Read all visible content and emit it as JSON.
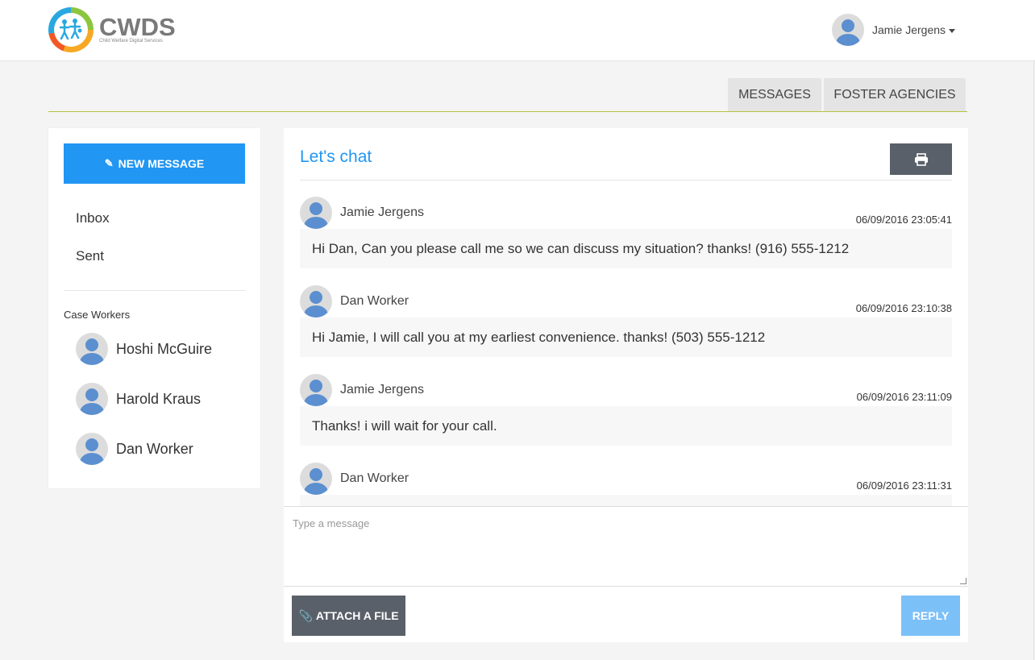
{
  "header": {
    "logo_text": "CWDS",
    "logo_subtitle": "Child Welfare Digital Services",
    "user_name": "Jamie Jergens"
  },
  "tabs": [
    {
      "label": "MESSAGES"
    },
    {
      "label": "FOSTER AGENCIES"
    }
  ],
  "sidebar": {
    "new_message_label": "NEW MESSAGE",
    "nav": [
      {
        "label": "Inbox"
      },
      {
        "label": "Sent"
      }
    ],
    "case_workers_title": "Case Workers",
    "case_workers": [
      {
        "name": "Hoshi McGuire"
      },
      {
        "name": "Harold Kraus"
      },
      {
        "name": "Dan Worker"
      }
    ]
  },
  "chat": {
    "title": "Let's chat",
    "messages": [
      {
        "sender": "Jamie Jergens",
        "timestamp": "06/09/2016 23:05:41",
        "text": "Hi Dan, Can you please call me so we can discuss my situation? thanks! (916) 555-1212"
      },
      {
        "sender": "Dan Worker",
        "timestamp": "06/09/2016 23:10:38",
        "text": "Hi Jamie, I will call you at my earliest convenience. thanks! (503) 555-1212"
      },
      {
        "sender": "Jamie Jergens",
        "timestamp": "06/09/2016 23:11:09",
        "text": "Thanks! i will wait for your call."
      },
      {
        "sender": "Dan Worker",
        "timestamp": "06/09/2016 23:11:31",
        "text": ""
      }
    ],
    "composer": {
      "placeholder": "Type a message",
      "value": ""
    },
    "attach_label": "ATTACH A FILE",
    "reply_label": "REPLY"
  },
  "colors": {
    "primary": "#2196f3",
    "dark_button": "#5a6069",
    "reply_disabled": "#7cc0f8",
    "tab_underline": "#b6c23f",
    "avatar": "#5b8fd0"
  },
  "icons": {
    "print": "printer-icon",
    "new_message": "edit-icon",
    "attach": "paperclip-icon",
    "dropdown": "caret-down-icon"
  }
}
